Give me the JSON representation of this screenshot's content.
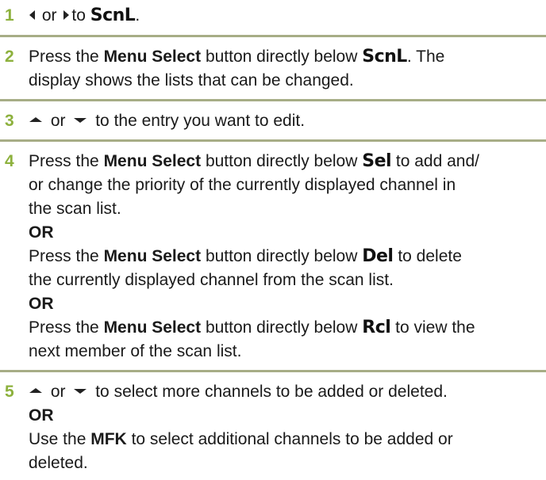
{
  "accent_color": "#8db13d",
  "rule_color": "#a7ad86",
  "icons": [
    "left-arrow-key-icon",
    "right-arrow-key-icon",
    "up-arrow-key-icon",
    "down-arrow-key-icon"
  ],
  "steps": [
    {
      "number": "1",
      "lines": [
        {
          "or": "or",
          "to": "to",
          "display": "ScnL",
          "end": "."
        }
      ]
    },
    {
      "number": "2",
      "lines": [
        {
          "pre": "Press the",
          "bold": "Menu Select",
          "mid": "button directly below",
          "display": "ScnL",
          "post": ". The"
        },
        {
          "text": "display shows the lists that can be changed."
        }
      ]
    },
    {
      "number": "3",
      "lines": [
        {
          "or": "or",
          "post": "to the entry you want to edit."
        }
      ]
    },
    {
      "number": "4",
      "lines": [
        {
          "pre": "Press the",
          "bold": "Menu Select",
          "mid": "button directly below",
          "display": "Sel",
          "post": "to add and/"
        },
        {
          "text": "or change the priority of the currently displayed channel in"
        },
        {
          "text": "the scan list."
        },
        {
          "bold": "OR"
        },
        {
          "pre": "Press the",
          "bold": "Menu Select",
          "mid": "button directly below",
          "display": "Del",
          "post": "to delete"
        },
        {
          "text": "the currently displayed channel from the scan list."
        },
        {
          "bold": "OR"
        },
        {
          "pre": "Press the",
          "bold": "Menu Select",
          "mid": "button directly below",
          "display": "Rcl",
          "post": "to view the"
        },
        {
          "text": "next member of the scan list."
        }
      ]
    },
    {
      "number": "5",
      "lines": [
        {
          "or": "or",
          "post": "to select more channels to be added or deleted."
        },
        {
          "bold": "OR"
        },
        {
          "pre": "Use the",
          "bold": "MFK",
          "post": "to select additional channels to be added or"
        },
        {
          "text": "deleted."
        }
      ]
    }
  ]
}
